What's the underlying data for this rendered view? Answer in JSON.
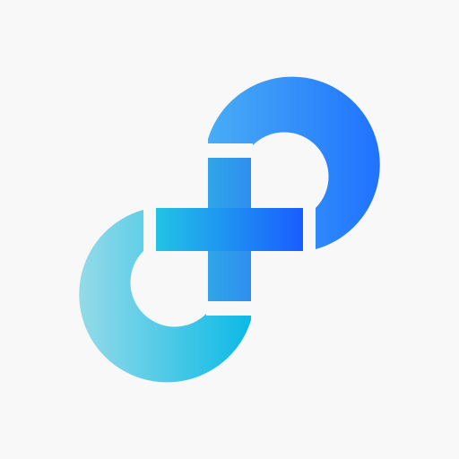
{
  "app": {
    "logo_icon": "infinity-plus-logo-icon",
    "colors": {
      "background": "#f8f8f8",
      "top_ring_start": "#49adf5",
      "top_ring_end": "#1a6bff",
      "bottom_ring_start": "#a6dfe9",
      "bottom_ring_end": "#0bb9e6",
      "plus_horizontal_start": "#22c3e5",
      "plus_horizontal_end": "#1a5dff",
      "plus_vertical_start": "#2fa5e8",
      "plus_vertical_end": "#2f8ff0"
    }
  }
}
